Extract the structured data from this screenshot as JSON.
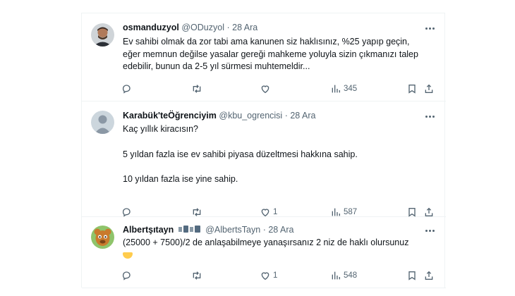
{
  "tweets": [
    {
      "name": "osmanduzyol",
      "handle": "@ODuzyol",
      "separator": "·",
      "date": "28 Ara",
      "lines": [
        "Ev sahibi olmak da zor tabi ama kanunen siz haklısınız, %25 yapıp geçin,",
        "eğer memnun değilse yasalar gereği mahkeme yoluyla sizin çıkmanızı talep",
        "edebilir, bunun da 2-5 yıl sürmesi muhtemeldir..."
      ],
      "views": "345"
    },
    {
      "name": "Karabük'teÖğrenciyim",
      "handle": "@kbu_ogrencisi",
      "separator": "·",
      "date": "28 Ara",
      "lines": [
        "Kaç yıllık kiracısın?",
        "5 yıldan fazla ise ev sahibi piyasa düzeltmesi hakkına sahip.",
        "10 yıldan fazla ise yine sahip."
      ],
      "likes": "1",
      "views": "587"
    },
    {
      "name": "Albertşıtayn",
      "handle": "@AlbertsTayn",
      "separator": "·",
      "date": "28 Ara",
      "lines": [
        "(25000 + 7500)/2 de anlaşabilmeye yanaşırsanız 2 niz de haklı olursunuz"
      ],
      "emoji": "smiling-face-with-hand-over-mouth",
      "likes": "1",
      "views": "548"
    }
  ],
  "colors": {
    "text": "#0f1419",
    "secondary": "#536471",
    "divider": "#eff3f4"
  }
}
